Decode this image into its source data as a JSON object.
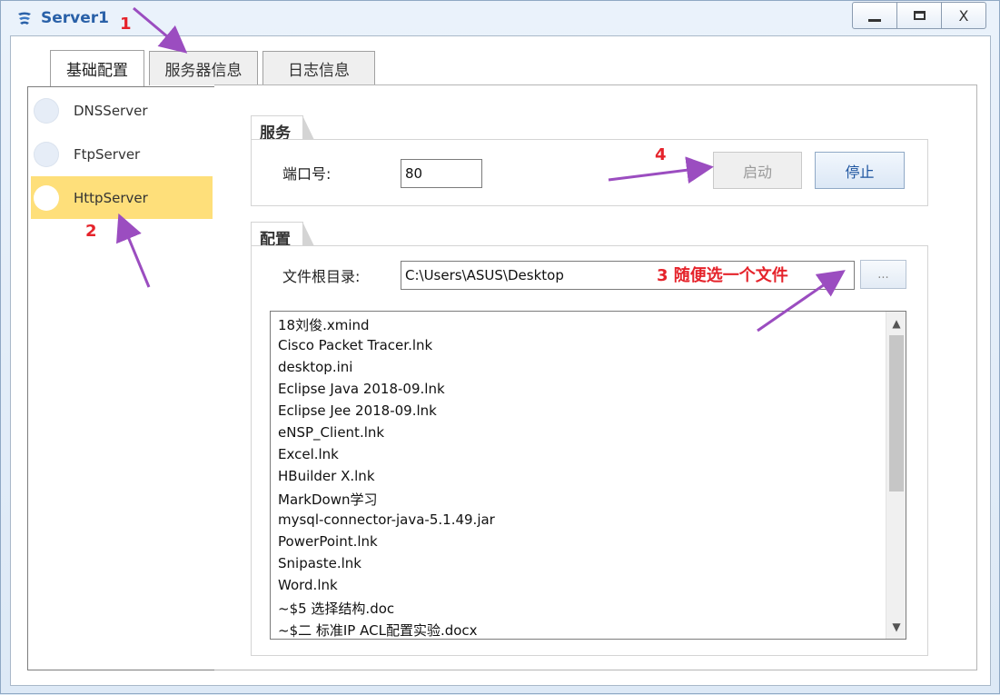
{
  "window": {
    "title": "Server1",
    "min_label": "—",
    "max_label": "☐",
    "close_label": "X"
  },
  "tabs": [
    {
      "label": "基础配置"
    },
    {
      "label": "服务器信息"
    },
    {
      "label": "日志信息"
    }
  ],
  "server_list": [
    {
      "label": "DNSServer",
      "selected": false
    },
    {
      "label": "FtpServer",
      "selected": false
    },
    {
      "label": "HttpServer",
      "selected": true
    }
  ],
  "service": {
    "group_title": "服务",
    "port_label": "端口号:",
    "port_value": "80",
    "start_label": "启动",
    "stop_label": "停止"
  },
  "config": {
    "group_title": "配置",
    "root_label": "文件根目录:",
    "root_value": "C:\\Users\\ASUS\\Desktop",
    "browse_label": "...",
    "files": [
      "18刘俊.xmind",
      "Cisco Packet Tracer.lnk",
      "desktop.ini",
      "Eclipse Java 2018-09.lnk",
      "Eclipse Jee 2018-09.lnk",
      "eNSP_Client.lnk",
      "Excel.lnk",
      "HBuilder X.lnk",
      "MarkDown学习",
      "mysql-connector-java-5.1.49.jar",
      "PowerPoint.lnk",
      "Snipaste.lnk",
      "Word.lnk",
      "~$5 选择结构.doc",
      "~$二 标准IP ACL配置实验.docx"
    ]
  },
  "annotations": {
    "a1": "1",
    "a2": "2",
    "a3": "3 随便选一个文件",
    "a4": "4",
    "color": "#e5232b",
    "arrow_color": "#9b4dc0"
  }
}
